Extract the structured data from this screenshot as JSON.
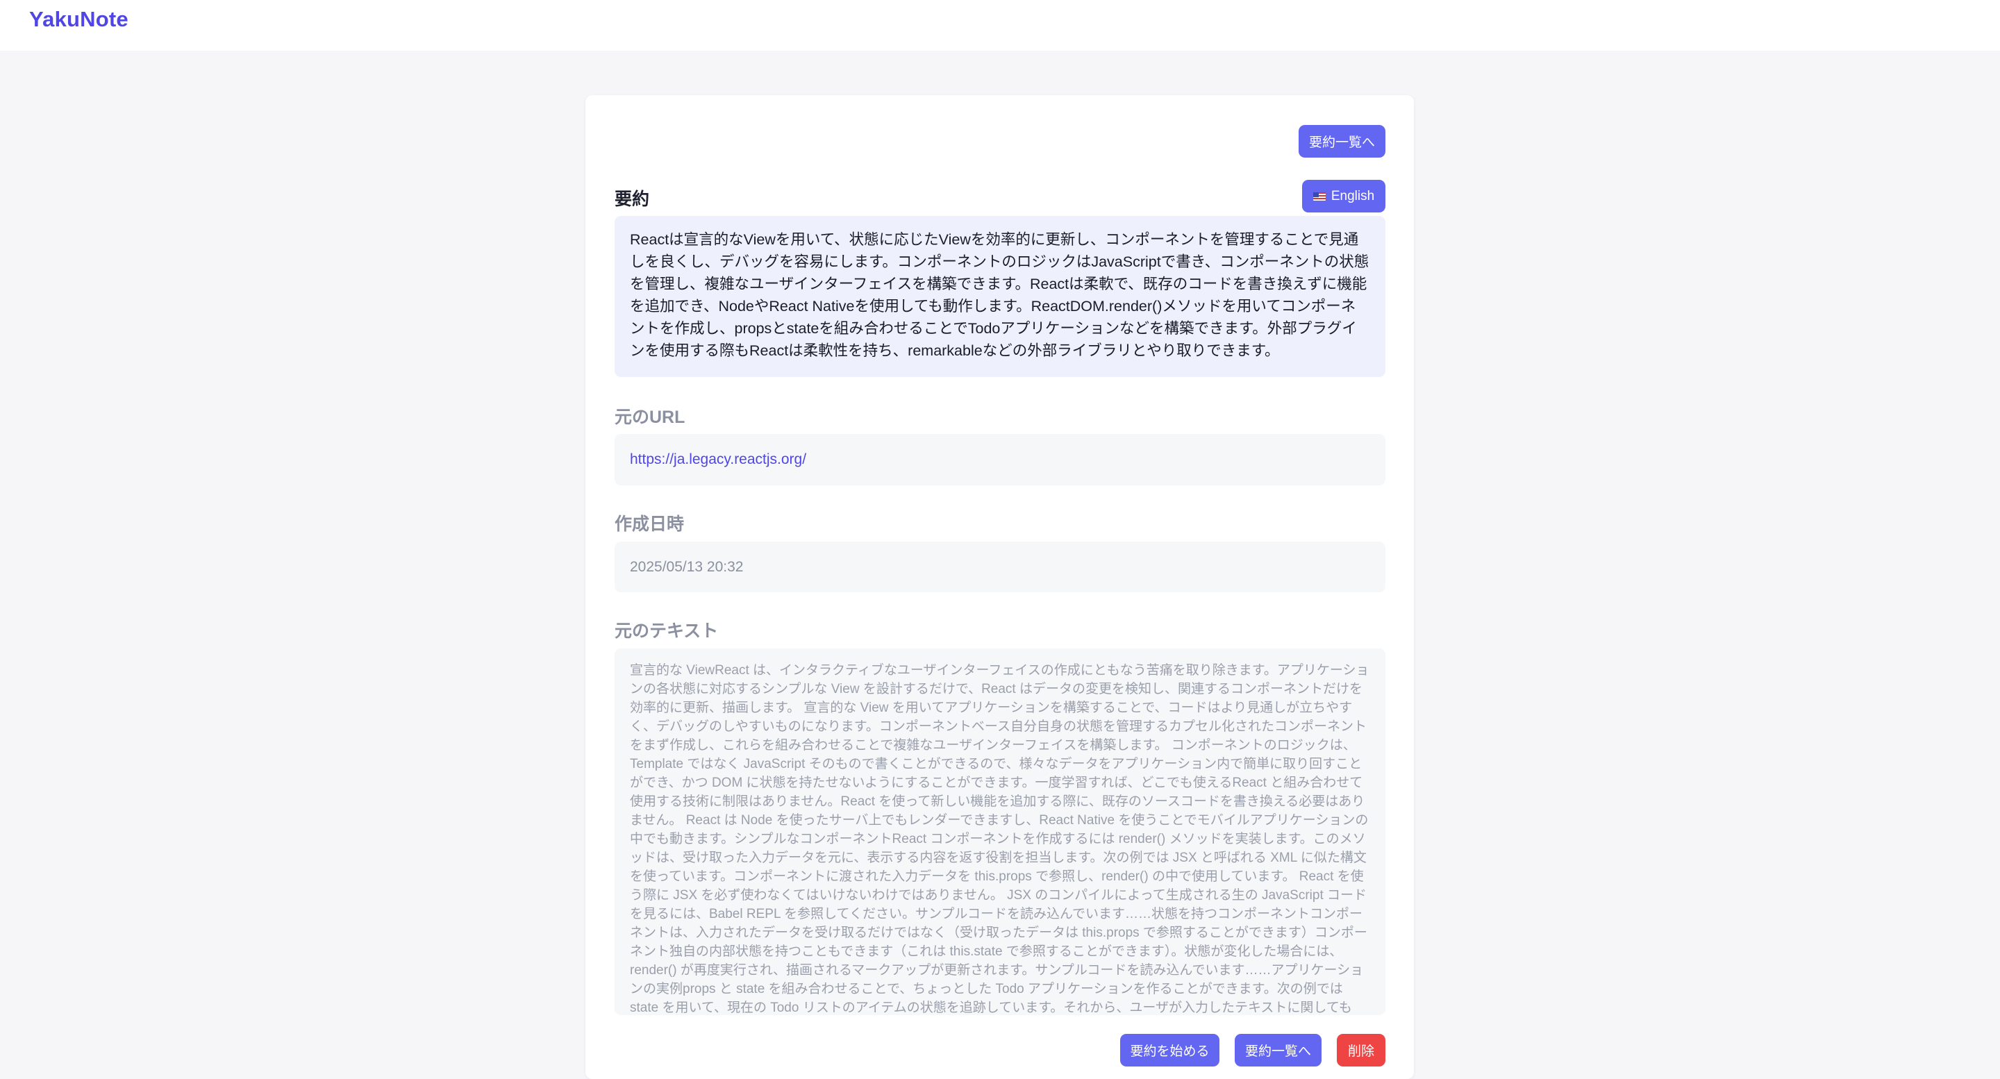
{
  "app": {
    "name": "YakuNote"
  },
  "header_actions": {
    "to_list_label": "要約一覧へ"
  },
  "summary": {
    "heading": "要約",
    "language_button": "English",
    "language_icon": "us-flag-icon",
    "text": "Reactは宣言的なViewを用いて、状態に応じたViewを効率的に更新し、コンポーネントを管理することで見通しを良くし、デバッグを容易にします。コンポーネントのロジックはJavaScriptで書き、コンポーネントの状態を管理し、複雑なユーザインターフェイスを構築できます。Reactは柔軟で、既存のコードを書き換えずに機能を追加でき、NodeやReact Nativeを使用しても動作します。ReactDOM.render()メソッドを用いてコンポーネントを作成し、propsとstateを組み合わせることでTodoアプリケーションなどを構築できます。外部プラグインを使用する際もReactは柔軟性を持ち、remarkableなどの外部ライブラリとやり取りできます。"
  },
  "source_url": {
    "heading": "元のURL",
    "value": "https://ja.legacy.reactjs.org/"
  },
  "created_at": {
    "heading": "作成日時",
    "value": "2025/05/13 20:32"
  },
  "source_text": {
    "heading": "元のテキスト",
    "value": "宣言的な ViewReact は、インタラクティブなユーザインターフェイスの作成にともなう苦痛を取り除きます。アプリケーションの各状態に対応するシンプルな View を設計するだけで、React はデータの変更を検知し、関連するコンポーネントだけを効率的に更新、描画します。 宣言的な View を用いてアプリケーションを構築することで、コードはより見通しが立ちやすく、デバッグのしやすいものになります。コンポーネントベース自分自身の状態を管理するカプセル化されたコンポーネントをまず作成し、これらを組み合わせることで複雑なユーザインターフェイスを構築します。 コンポーネントのロジックは、Template ではなく JavaScript そのもので書くことができるので、様々なデータをアプリケーション内で簡単に取り回すことができ、かつ DOM に状態を持たせないようにすることができます。一度学習すれば、どこでも使えるReact と組み合わせて使用する技術に制限はありません。React を使って新しい機能を追加する際に、既存のソースコードを書き換える必要はありません。 React は Node を使ったサーバ上でもレンダーできますし、React Native を使うことでモバイルアプリケーションの中でも動きます。シンプルなコンポーネントReact コンポーネントを作成するには render() メソッドを実装します。このメソッドは、受け取った入力データを元に、表示する内容を返す役割を担当します。次の例では JSX と呼ばれる XML に似た構文を使っています。コンポーネントに渡された入力データを this.props で参照し、render() の中で使用しています。 React を使う際に JSX を必ず使わなくてはいけないわけではありません。 JSX のコンパイルによって生成される生の JavaScript コードを見るには、Babel REPL を参照してください。サンプルコードを読み込んでいます……状態を持つコンポーネントコンポーネントは、入力されたデータを受け取るだけではなく（受け取ったデータは this.props で参照することができます）コンポーネント独自の内部状態を持つこともできます（これは this.state で参照することができます）。状態が変化した場合には、render() が再度実行され、描画されるマークアップが更新されます。サンプルコードを読み込んでいます……アプリケーションの実例props と state を組み合わせることで、ちょっとした Todo アプリケーションを作ることができます。次の例では state を用いて、現在の Todo リストのアイテムの状態を追跡しています。それから、ユーザが入力したテキストに関しても state で管理しています。イベントハンドラは、それが書"
  },
  "footer_actions": {
    "start_summary_label": "要約を始める",
    "to_list_label": "要約一覧へ",
    "delete_label": "削除"
  },
  "colors": {
    "brand": "#4f46e5",
    "primary_button": "#6366f1",
    "danger_button": "#ef4444",
    "summary_background": "#eef0fd"
  }
}
